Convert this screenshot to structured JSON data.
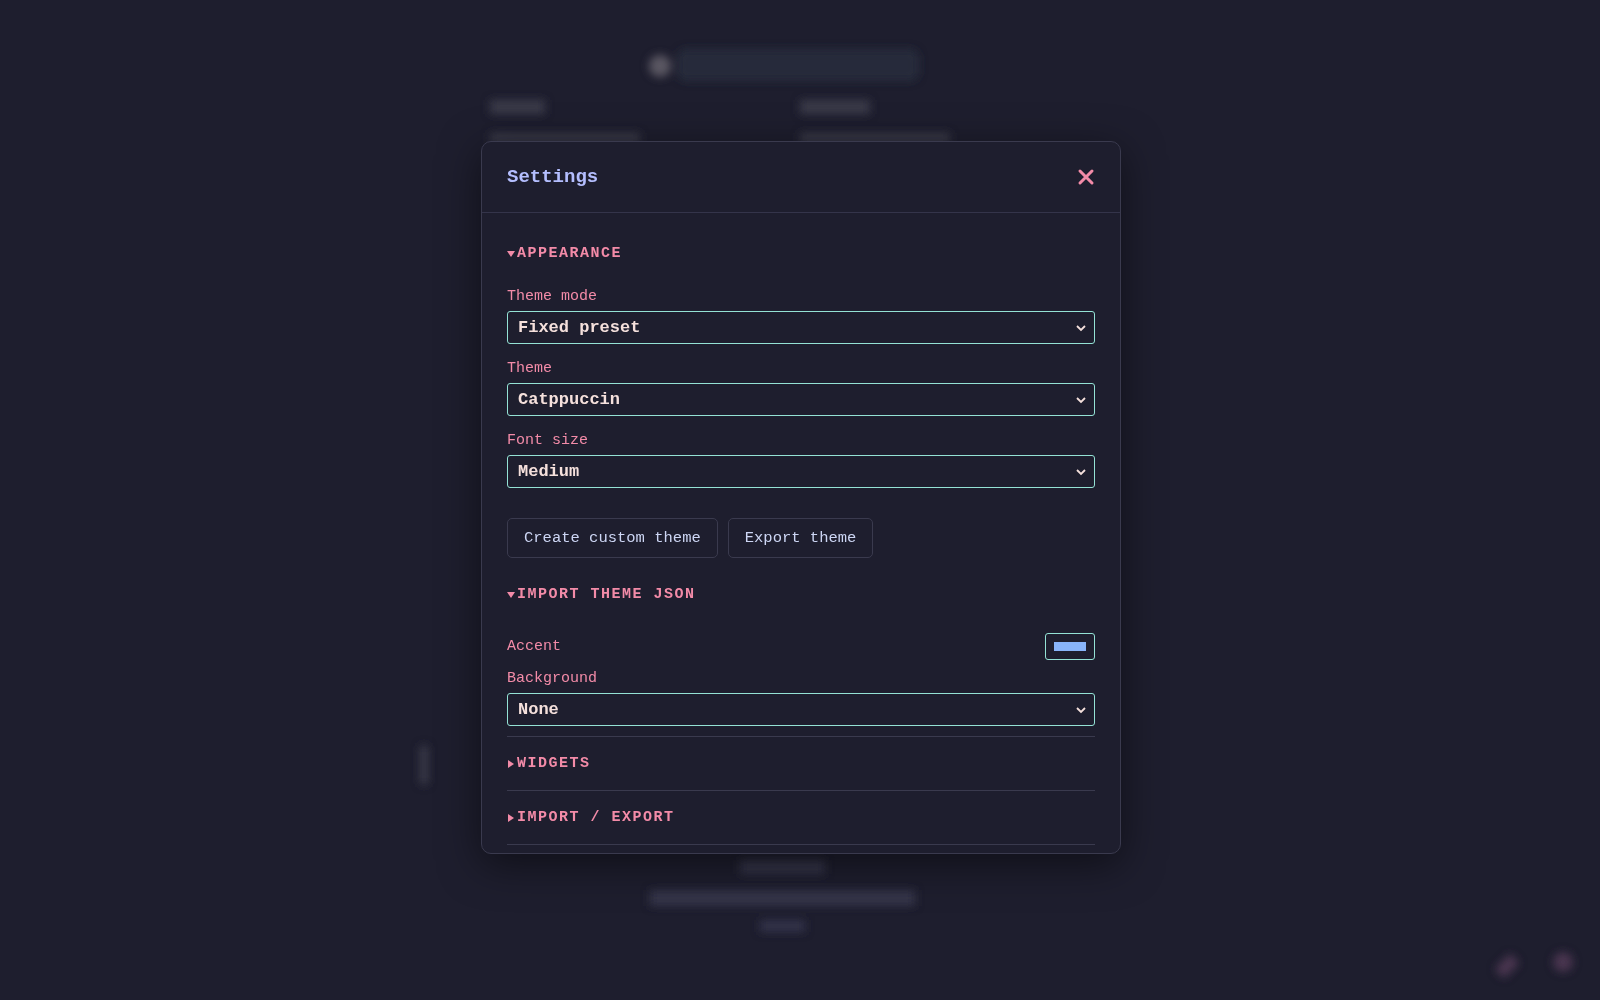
{
  "dialog": {
    "title": "Settings"
  },
  "sections": [
    {
      "title": "APPEARANCE",
      "expanded": true,
      "items": [
        {
          "kind": "select",
          "label": "Theme mode",
          "value": "Fixed preset"
        },
        {
          "kind": "select",
          "label": "Theme",
          "value": "Catppuccin"
        },
        {
          "kind": "select",
          "label": "Font size",
          "value": "Medium"
        },
        {
          "kind": "buttons",
          "buttons": [
            "Create custom theme",
            "Export theme"
          ]
        },
        {
          "kind": "section",
          "title": "IMPORT THEME JSON",
          "expanded": true,
          "items": [
            {
              "kind": "color",
              "label": "Accent",
              "color": "#89b4fa"
            },
            {
              "kind": "select",
              "label": "Background",
              "value": "None"
            }
          ]
        }
      ]
    },
    {
      "title": "WIDGETS",
      "expanded": false
    },
    {
      "title": "IMPORT / EXPORT",
      "expanded": false
    }
  ]
}
